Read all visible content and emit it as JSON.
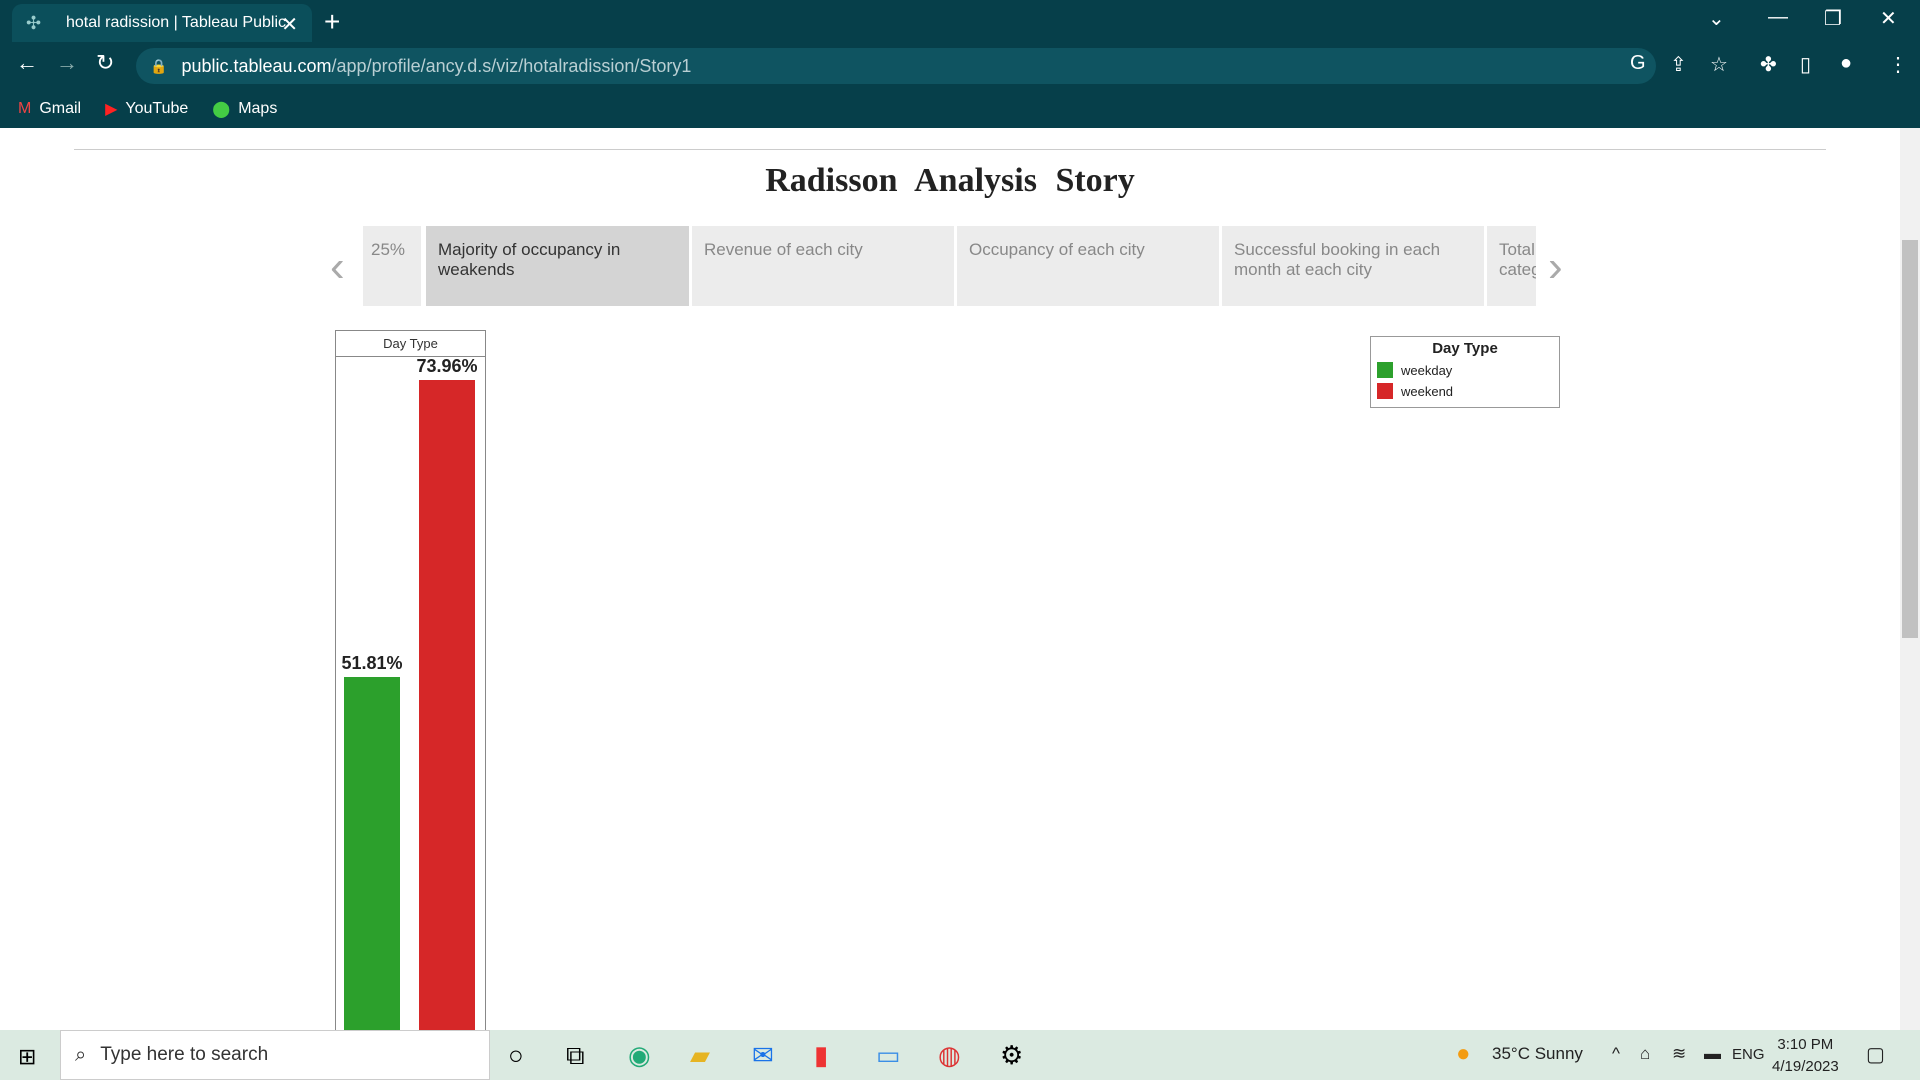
{
  "browser": {
    "tab_title": "hotal radission | Tableau Public",
    "url_host": "public.tableau.com",
    "url_path": "/app/profile/ancy.d.s/viz/hotalradission/Story1"
  },
  "bookmarks": [
    "Gmail",
    "YouTube",
    "Maps"
  ],
  "page": {
    "story_title": "Radisson  Analysis  Story",
    "story_points": [
      {
        "label": "25%"
      },
      {
        "label": "Majority of occupancy in weakends"
      },
      {
        "label": "Revenue of each city"
      },
      {
        "label": "Occupancy of each city"
      },
      {
        "label": "Successful booking in each month at each city"
      },
      {
        "label": "Total categ"
      }
    ]
  },
  "chart_data": {
    "type": "bar",
    "header": "Day Type",
    "categories": [
      "weekday",
      "weekend"
    ],
    "values": [
      51.81,
      73.96
    ],
    "data_labels": [
      "51.81%",
      "73.96%"
    ],
    "colors": [
      "#2ca02c",
      "#d62728"
    ],
    "legend": {
      "title": "Day Type",
      "entries": [
        "weekday",
        "weekend"
      ],
      "placement": "top-right"
    }
  },
  "taskbar": {
    "search_placeholder": "Type here to search",
    "weather": "35°C  Sunny",
    "language": "ENG",
    "time": "3:10 PM",
    "date": "4/19/2023"
  }
}
